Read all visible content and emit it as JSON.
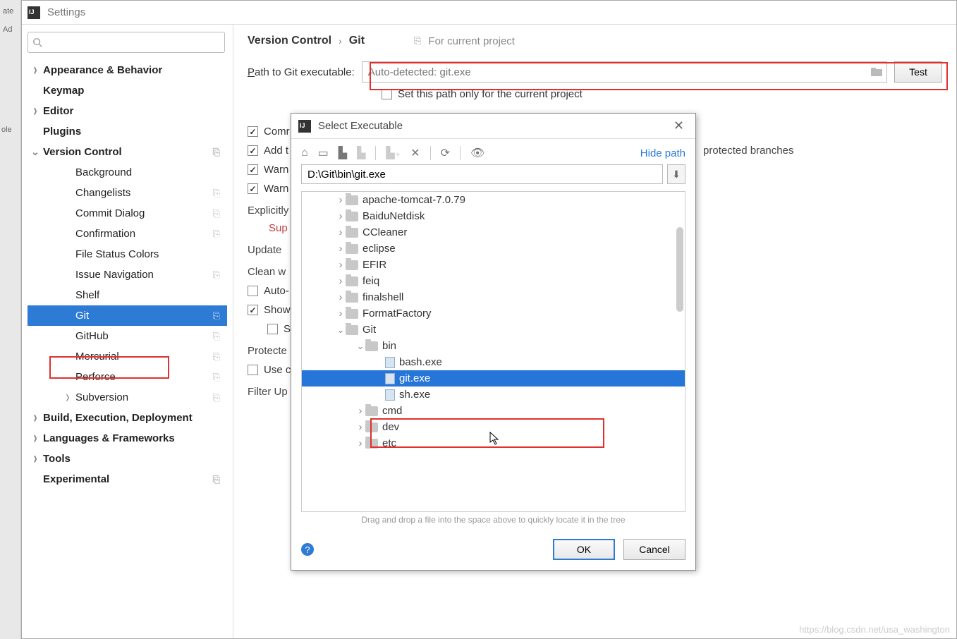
{
  "window": {
    "title": "Settings"
  },
  "bg_left": {
    "line1": "ate",
    "line2": "Ad",
    "line3": "ole"
  },
  "search": {
    "placeholder": ""
  },
  "sidebar": {
    "items": [
      {
        "label": "Appearance & Behavior",
        "bold": true,
        "arrow": "right",
        "indent": 0
      },
      {
        "label": "Keymap",
        "bold": true,
        "arrow": "",
        "indent": 0
      },
      {
        "label": "Editor",
        "bold": true,
        "arrow": "right",
        "indent": 0
      },
      {
        "label": "Plugins",
        "bold": true,
        "arrow": "",
        "indent": 0
      },
      {
        "label": "Version Control",
        "bold": true,
        "arrow": "down",
        "indent": 0,
        "proj": true
      },
      {
        "label": "Background",
        "bold": false,
        "arrow": "",
        "indent": 2
      },
      {
        "label": "Changelists",
        "bold": false,
        "arrow": "",
        "indent": 2,
        "proj": true
      },
      {
        "label": "Commit Dialog",
        "bold": false,
        "arrow": "",
        "indent": 2,
        "proj": true
      },
      {
        "label": "Confirmation",
        "bold": false,
        "arrow": "",
        "indent": 2,
        "proj": true
      },
      {
        "label": "File Status Colors",
        "bold": false,
        "arrow": "",
        "indent": 2
      },
      {
        "label": "Issue Navigation",
        "bold": false,
        "arrow": "",
        "indent": 2,
        "proj": true
      },
      {
        "label": "Shelf",
        "bold": false,
        "arrow": "",
        "indent": 2
      },
      {
        "label": "Git",
        "bold": false,
        "arrow": "",
        "indent": 2,
        "selected": true,
        "proj": true
      },
      {
        "label": "GitHub",
        "bold": false,
        "arrow": "",
        "indent": 2,
        "proj": true
      },
      {
        "label": "Mercurial",
        "bold": false,
        "arrow": "",
        "indent": 2,
        "proj": true
      },
      {
        "label": "Perforce",
        "bold": false,
        "arrow": "",
        "indent": 2,
        "proj": true
      },
      {
        "label": "Subversion",
        "bold": false,
        "arrow": "right",
        "indent": 2,
        "proj": true
      },
      {
        "label": "Build, Execution, Deployment",
        "bold": true,
        "arrow": "right",
        "indent": 0
      },
      {
        "label": "Languages & Frameworks",
        "bold": true,
        "arrow": "right",
        "indent": 0
      },
      {
        "label": "Tools",
        "bold": true,
        "arrow": "right",
        "indent": 0
      },
      {
        "label": "Experimental",
        "bold": true,
        "arrow": "",
        "indent": 0,
        "proj": true
      }
    ]
  },
  "breadcrumb": {
    "parent": "Version Control",
    "child": "Git",
    "scope": "For current project"
  },
  "git_path": {
    "label_pre": "P",
    "label_rest": "ath to Git executable:",
    "placeholder": "Auto-detected: git.exe",
    "test_label": "Test",
    "chk_only_project": "Set this path only for the current project"
  },
  "checks": {
    "commit_auto": "Comr",
    "add_track": "Add t",
    "warn_crlf": "Warn",
    "warn_detached": "Warn",
    "explicitly": "Explicitly",
    "support": "Sup",
    "update_method": "Update",
    "clean": "Clean w",
    "auto_update": "Auto-",
    "show_push": "Show",
    "sh": "Sh",
    "protected": "Protecte",
    "use_cred": "Use c",
    "filter": "Filter Up",
    "right_branches": "protected branches"
  },
  "dialog": {
    "title": "Select Executable",
    "hide_path": "Hide path",
    "path_value": "D:\\Git\\bin\\git.exe",
    "tree": [
      {
        "label": "apache-tomcat-7.0.79",
        "type": "folder",
        "indent": 1,
        "arrow": "col"
      },
      {
        "label": "BaiduNetdisk",
        "type": "folder",
        "indent": 1,
        "arrow": "col"
      },
      {
        "label": "CCleaner",
        "type": "folder",
        "indent": 1,
        "arrow": "col"
      },
      {
        "label": "eclipse",
        "type": "folder",
        "indent": 1,
        "arrow": "col"
      },
      {
        "label": "EFIR",
        "type": "folder",
        "indent": 1,
        "arrow": "col"
      },
      {
        "label": "feiq",
        "type": "folder",
        "indent": 1,
        "arrow": "col"
      },
      {
        "label": "finalshell",
        "type": "folder",
        "indent": 1,
        "arrow": "col"
      },
      {
        "label": "FormatFactory",
        "type": "folder",
        "indent": 1,
        "arrow": "col"
      },
      {
        "label": "Git",
        "type": "folder",
        "indent": 1,
        "arrow": "exp"
      },
      {
        "label": "bin",
        "type": "folder",
        "indent": 2,
        "arrow": "exp"
      },
      {
        "label": "bash.exe",
        "type": "file",
        "indent": 3,
        "arrow": ""
      },
      {
        "label": "git.exe",
        "type": "file",
        "indent": 3,
        "arrow": "",
        "selected": true
      },
      {
        "label": "sh.exe",
        "type": "file",
        "indent": 3,
        "arrow": ""
      },
      {
        "label": "cmd",
        "type": "folder",
        "indent": 2,
        "arrow": "col"
      },
      {
        "label": "dev",
        "type": "folder",
        "indent": 2,
        "arrow": "col"
      },
      {
        "label": "etc",
        "type": "folder",
        "indent": 2,
        "arrow": "col"
      }
    ],
    "hint": "Drag and drop a file into the space above to quickly locate it in the tree",
    "ok": "OK",
    "cancel": "Cancel"
  },
  "watermark": "https://blog.csdn.net/usa_washington"
}
